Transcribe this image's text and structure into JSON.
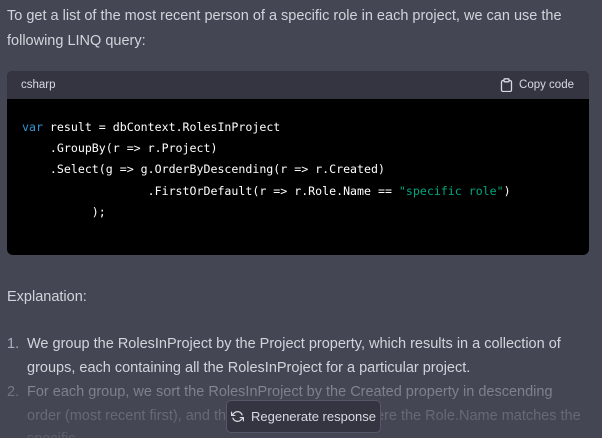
{
  "message": {
    "intro": "To get a list of the most recent person of a specific role in each project, we can use the following LINQ query:",
    "explanation_heading": "Explanation:",
    "steps": [
      {
        "number": "1.",
        "text": "We group the RolesInProject by the Project property, which results in a collection of groups, each containing all the RolesInProject for a particular project."
      },
      {
        "number": "2.",
        "text": "For each group, we sort the RolesInProject by the Created property in descending order (most recent first), and then take the first one where the Role.Name matches the specific"
      }
    ]
  },
  "code_block": {
    "language": "csharp",
    "copy_label": "Copy code",
    "copy_icon": "clipboard-icon",
    "lines": [
      {
        "tokens": [
          {
            "t": "kw",
            "v": "var"
          },
          {
            "t": "plain",
            "v": " result = dbContext.RolesInProject"
          }
        ]
      },
      {
        "tokens": [
          {
            "t": "plain",
            "v": "    .GroupBy(r => r.Project)"
          }
        ]
      },
      {
        "tokens": [
          {
            "t": "plain",
            "v": "    .Select(g => g.OrderByDescending(r => r.Created)"
          }
        ]
      },
      {
        "tokens": [
          {
            "t": "plain",
            "v": "                  .FirstOrDefault(r => r.Role.Name == "
          },
          {
            "t": "str",
            "v": "\"specific role\""
          },
          {
            "t": "plain",
            "v": ")"
          }
        ]
      },
      {
        "tokens": [
          {
            "t": "plain",
            "v": "          );"
          }
        ]
      }
    ]
  },
  "regenerate": {
    "label": "Regenerate response",
    "icon": "refresh-icon"
  },
  "colors": {
    "background": "#444654",
    "code_background": "#000000",
    "code_header": "#343541",
    "keyword": "#2e95d3",
    "string": "#00a67d",
    "text": "#d1d5db"
  }
}
